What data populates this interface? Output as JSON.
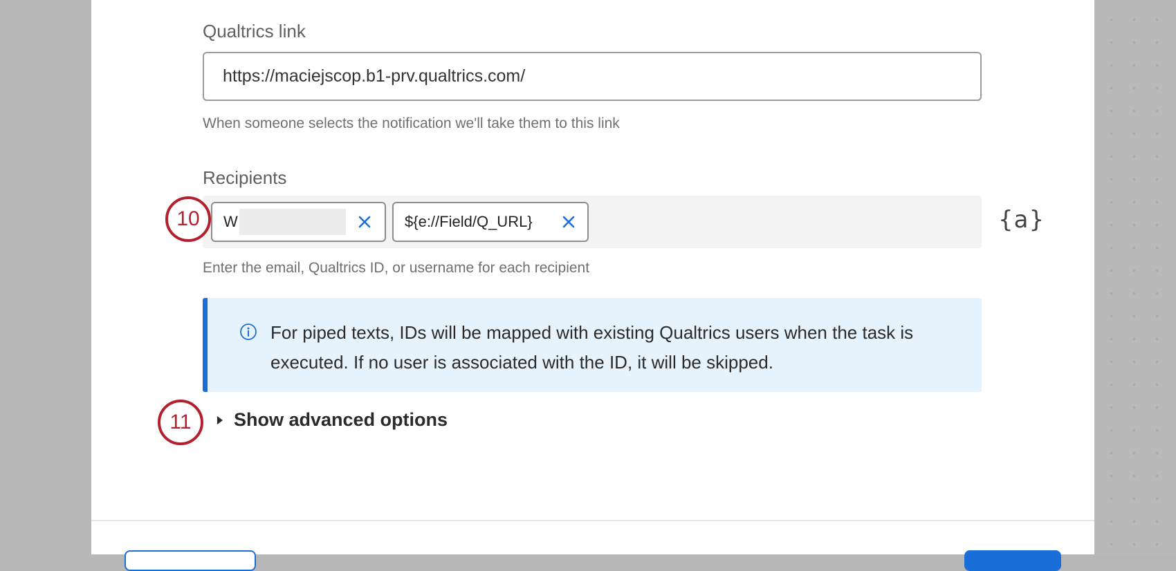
{
  "form": {
    "link_label": "Qualtrics link",
    "link_value": "https://maciejscop.b1-prv.qualtrics.com/",
    "link_help": "When someone selects the notification we'll take them to this link",
    "recipients_label": "Recipients",
    "recipients": [
      {
        "text": "W"
      },
      {
        "text": "${e://Field/Q_URL}"
      }
    ],
    "piped_text_button": "{a}",
    "recipients_help": "Enter the email, Qualtrics ID, or username for each recipient",
    "info_message": "For piped texts, IDs will be mapped with existing Qualtrics users when the task is executed. If no user is associated with the ID, it will be skipped.",
    "advanced_toggle": "Show advanced options"
  },
  "annotations": {
    "marker_10": "10",
    "marker_11": "11"
  },
  "colors": {
    "accent": "#1a6ed8",
    "info_bg": "#e6f3fc",
    "annotation": "#b3202e"
  }
}
